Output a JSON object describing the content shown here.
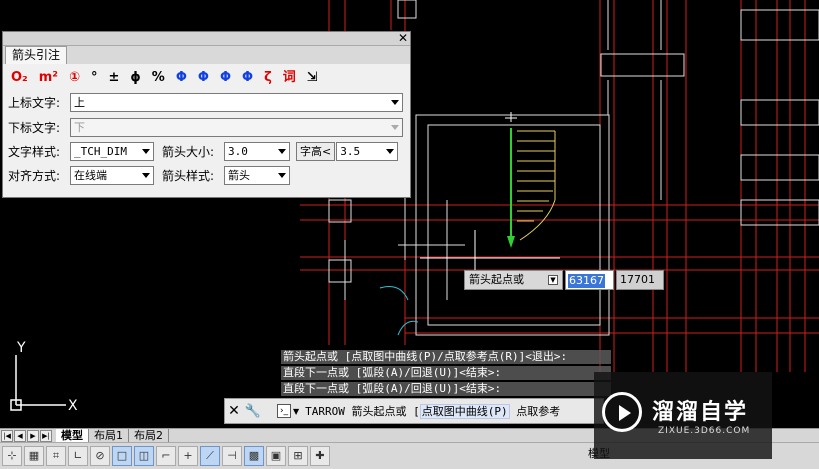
{
  "dialog": {
    "tab_label": "箭头引注",
    "close_glyph": "✕",
    "symbols": [
      {
        "text": "O₂",
        "color": "red"
      },
      {
        "text": "m²",
        "color": "red"
      },
      {
        "text": "①",
        "color": "red"
      },
      {
        "text": "°",
        "color": "black"
      },
      {
        "text": "±",
        "color": "black"
      },
      {
        "text": "ϕ",
        "color": "black"
      },
      {
        "text": "%",
        "color": "black"
      },
      {
        "text": "Φ",
        "color": "blue"
      },
      {
        "text": "Φ",
        "color": "blue"
      },
      {
        "text": "Φ",
        "color": "blue"
      },
      {
        "text": "Φ",
        "color": "blue"
      },
      {
        "text": "ζ",
        "color": "red"
      },
      {
        "text": "词",
        "color": "red"
      },
      {
        "text": "⇲",
        "color": "black"
      }
    ],
    "upper_text_label": "上标文字:",
    "upper_text_value": "上",
    "lower_text_label": "下标文字:",
    "lower_text_value": "下",
    "text_style_label": "文字样式:",
    "text_style_value": "_TCH_DIM",
    "arrow_size_label": "箭头大小:",
    "arrow_size_value": "3.0",
    "char_height_button": "字高<",
    "char_height_value": "3.5",
    "align_label": "对齐方式:",
    "align_value": "在线端",
    "arrow_style_label": "箭头样式:",
    "arrow_style_value": "箭头"
  },
  "prompt": {
    "label": "箭头起点或",
    "x_value": "63167",
    "y_value": "17701"
  },
  "history": [
    "箭头起点或 [点取图中曲线(P)/点取参考点(R)]<退出>:",
    "直段下一点或 [弧段(A)/回退(U)]<结束>:",
    "直段下一点或 [弧段(A)/回退(U)]<结束>:"
  ],
  "command": {
    "prefix": "TARROW 箭头起点或 [",
    "option": "点取图中曲线(P)",
    "suffix": " 点取参考"
  },
  "layouts": {
    "tabs": [
      "模型",
      "布局1",
      "布局2"
    ]
  },
  "status": {
    "model_label": "模型"
  },
  "ucs": {
    "x_label": "X",
    "y_label": "Y"
  },
  "watermark": {
    "title": "溜溜自学",
    "url": "ZIXUE.3D66.COM"
  }
}
